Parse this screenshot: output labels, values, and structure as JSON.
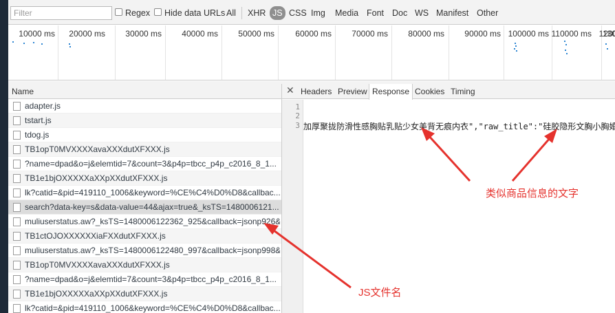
{
  "filter": {
    "placeholder": "Filter",
    "regex_label": "Regex",
    "hide_data_urls_label": "Hide data URLs",
    "types": [
      "All",
      "XHR",
      "JS",
      "CSS",
      "Img",
      "Media",
      "Font",
      "Doc",
      "WS",
      "Manifest",
      "Other"
    ],
    "active_type": "JS"
  },
  "overview": {
    "ticks": [
      "10000 ms",
      "20000 ms",
      "30000 ms",
      "40000 ms",
      "50000 ms",
      "60000 ms",
      "70000 ms",
      "80000 ms",
      "90000 ms",
      "100000 ms",
      "110000 ms",
      "120000 ms",
      "1300"
    ]
  },
  "list": {
    "header": "Name",
    "rows": [
      "adapter.js",
      "tstart.js",
      "tdog.js",
      "TB1opT0MVXXXXavaXXXdutXFXXX.js",
      "?name=dpad&o=j&elemtid=7&count=3&p4p=tbcc_p4p_c2016_8_1...",
      "TB1e1bjOXXXXXaXXpXXdutXFXXX.js",
      "lk?catid=&pid=419110_1006&keyword=%CE%C4%D0%D8&callbac...",
      "search?data-key=s&data-value=44&ajax=true&_ksTS=1480006121...",
      "muliuserstatus.aw?_ksTS=1480006122362_925&callback=jsonp926&...",
      "TB1ctOJOXXXXXXiaFXXdutXFXXX.js",
      "muliuserstatus.aw?_ksTS=1480006122480_997&callback=jsonp998&...",
      "TB1opT0MVXXXXavaXXXdutXFXXX.js",
      "?name=dpad&o=j&elemtid=7&count=3&p4p=tbcc_p4p_c2016_8_1...",
      "TB1e1bjOXXXXXaXXpXXdutXFXXX.js",
      "lk?catid=&pid=419110_1006&keyword=%CE%C4%D0%D8&callbac..."
    ],
    "selected_index": 7
  },
  "detail": {
    "close_label": "✕",
    "tabs": [
      "Headers",
      "Preview",
      "Response",
      "Cookies",
      "Timing"
    ],
    "active_tab": "Response",
    "line_numbers": [
      "1",
      "2",
      "3"
    ],
    "code_line_3": "加厚聚拢防滑性感胸贴乳贴少女美背无痕内衣\",\"raw_title\":\"硅胶隐形文胸小胸婚纱"
  },
  "annotations": {
    "product_text": "类似商品信息的文字",
    "js_filename": "JS文件名"
  },
  "colors": {
    "annotation": "#e5322d",
    "selected_row": "#dcdcdc",
    "toolbar": "#f3f3f3"
  }
}
